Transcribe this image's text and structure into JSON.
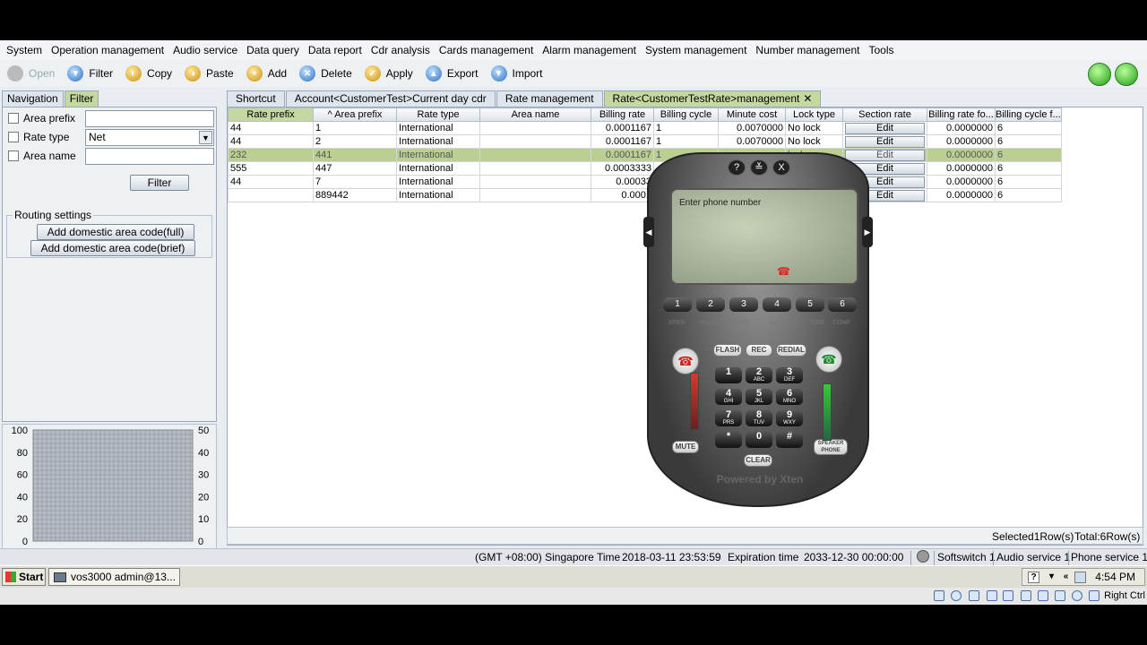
{
  "menu": [
    "System",
    "Operation management",
    "Audio service",
    "Data query",
    "Data report",
    "Cdr analysis",
    "Cards management",
    "Alarm management",
    "System management",
    "Number management",
    "Tools"
  ],
  "toolbar": {
    "open": "Open",
    "filter": "Filter",
    "copy": "Copy",
    "paste": "Paste",
    "add": "Add",
    "delete": "Delete",
    "apply": "Apply",
    "export": "Export",
    "import": "Import"
  },
  "left": {
    "tab_navigation": "Navigation",
    "tab_filter": "Filter",
    "area_prefix_label": "Area prefix",
    "rate_type_label": "Rate type",
    "rate_type_value": "Net",
    "area_name_label": "Area name",
    "filter_button": "Filter",
    "routing_settings": "Routing settings",
    "add_full": "Add domestic area code(full)",
    "add_brief": "Add domestic area code(brief)"
  },
  "chart": {
    "left_ticks": [
      "100",
      "80",
      "60",
      "40",
      "20",
      "0"
    ],
    "right_ticks": [
      "50",
      "40",
      "30",
      "20",
      "10",
      "0"
    ],
    "grid_color": "#7a8088"
  },
  "main": {
    "tabs": [
      "Shortcut",
      "Account<CustomerTest>Current day cdr",
      "Rate management",
      "Rate<CustomerTestRate>management"
    ],
    "close_icon": "✕",
    "columns": [
      "Rate prefix",
      "Area prefix",
      "Rate type",
      "Area name",
      "Billing rate",
      "Billing cycle",
      "Minute cost",
      "Lock type",
      "Section rate",
      "Billing rate fo...",
      "Billing cycle f..."
    ],
    "sort_marker": "^",
    "rows": [
      [
        "44",
        "1",
        "International",
        "",
        "0.0001167",
        "1",
        "0.0070000",
        "No lock",
        "Edit",
        "0.0000000",
        "6"
      ],
      [
        "44",
        "2",
        "International",
        "",
        "0.0001167",
        "1",
        "0.0070000",
        "No lock",
        "Edit",
        "0.0000000",
        "6"
      ],
      [
        "232",
        "441",
        "International",
        "",
        "0.0001167",
        "1",
        "",
        "lock",
        "Edit",
        "0.0000000",
        "6"
      ],
      [
        "555",
        "447",
        "International",
        "",
        "0.0003333",
        "",
        "",
        "",
        "Edit",
        "0.0000000",
        "6"
      ],
      [
        "44",
        "7",
        "International",
        "",
        "0.00033",
        "",
        "",
        "",
        "Edit",
        "0.0000000",
        "6"
      ],
      [
        "",
        "889442",
        "International",
        "",
        "0.0001",
        "",
        "",
        "",
        "Edit",
        "0.0000000",
        "6"
      ]
    ],
    "selected_row": 2,
    "selected_text": "Selected1Row(s)",
    "total_text": "Total:6Row(s)"
  },
  "status": {
    "timezone": "(GMT +08:00) Singapore Time",
    "datetime": "2018-03-11 23:53:59",
    "expiration_label": "Expiration time",
    "expiration_value": "2033-12-30 00:00:00",
    "softswitch": "Softswitch 1",
    "audio_service": "Audio service 1",
    "phone_service": "Phone service 1"
  },
  "taskbar": {
    "start": "Start",
    "task": "vos3000 admin@13...",
    "clock": "4:54 PM",
    "right_ctrl": "Right Ctrl"
  },
  "phone": {
    "enter_number": "Enter phone number",
    "top_buttons": [
      "?",
      "≚",
      "X"
    ],
    "line_keys": [
      "1",
      "2",
      "3",
      "4",
      "5",
      "6"
    ],
    "func_keys": [
      "XFER",
      "HOLD",
      "PARK",
      "AA",
      "AC",
      "DND",
      "CONF"
    ],
    "flash": "FLASH",
    "rec": "REC",
    "redial": "REDIAL",
    "keys": [
      [
        "1",
        ""
      ],
      [
        "2",
        "ABC"
      ],
      [
        "3",
        "DEF"
      ],
      [
        "4",
        "GHI"
      ],
      [
        "5",
        "JKL"
      ],
      [
        "6",
        "MNO"
      ],
      [
        "7",
        "PRS"
      ],
      [
        "8",
        "TUV"
      ],
      [
        "9",
        "WXY"
      ],
      [
        "*",
        ""
      ],
      [
        "0",
        ""
      ],
      [
        "#",
        ""
      ]
    ],
    "clear": "CLEAR",
    "mute": "MUTE",
    "speaker": "SPEAKER PHONE",
    "powered": "Powered by Xten"
  }
}
